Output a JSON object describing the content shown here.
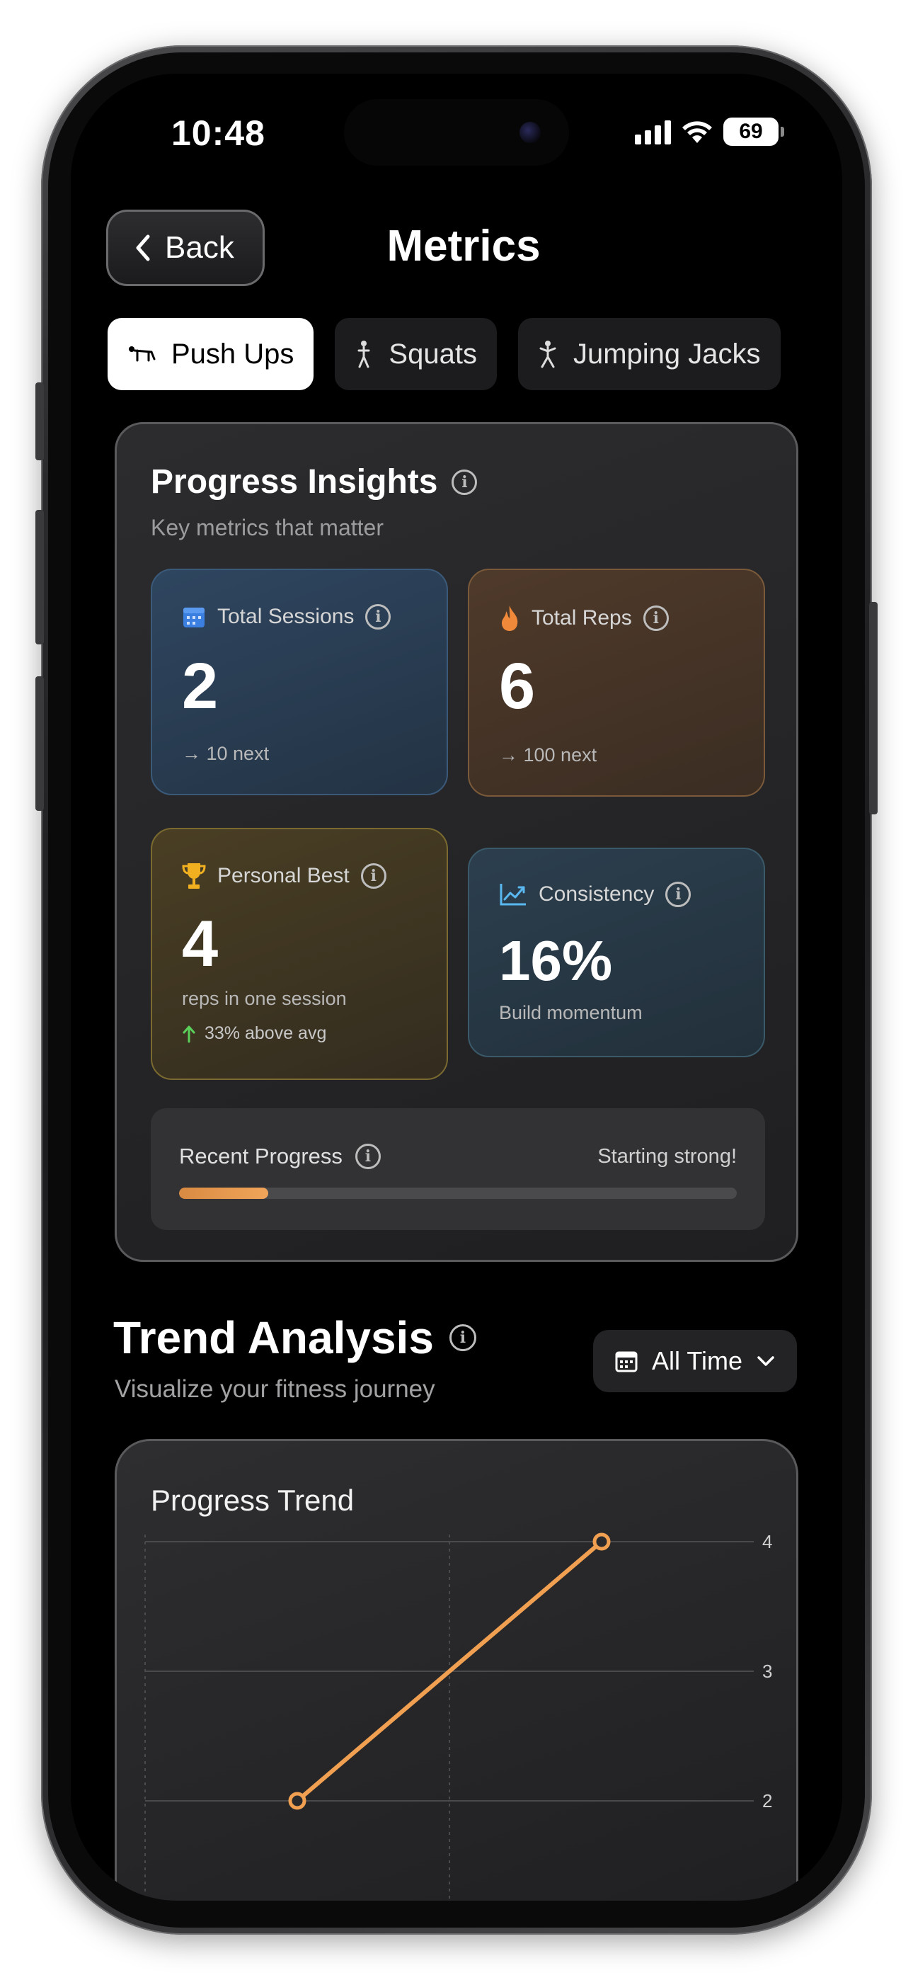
{
  "status": {
    "time": "10:48",
    "battery": "69"
  },
  "header": {
    "back_label": "Back",
    "title": "Metrics"
  },
  "tabs": [
    {
      "label": "Push Ups",
      "icon": "push-up-figure",
      "active": true
    },
    {
      "label": "Squats",
      "icon": "standing-figure",
      "active": false
    },
    {
      "label": "Jumping Jacks",
      "icon": "jumping-figure",
      "active": false
    }
  ],
  "insights": {
    "title": "Progress Insights",
    "subtitle": "Key metrics that matter",
    "sessions": {
      "label": "Total Sessions",
      "value": "2",
      "note": "→ 10 next",
      "icon": "calendar-icon"
    },
    "reps": {
      "label": "Total Reps",
      "value": "6",
      "note": "→ 100 next",
      "icon": "flame-icon"
    },
    "best": {
      "label": "Personal Best",
      "value": "4",
      "note": "reps in one session",
      "delta": "33% above avg",
      "icon": "trophy-icon"
    },
    "consistency": {
      "label": "Consistency",
      "value": "16%",
      "note": "Build momentum",
      "icon": "trend-chart-icon"
    },
    "recent": {
      "label": "Recent Progress",
      "status": "Starting strong!",
      "progress": 0.16
    }
  },
  "trend": {
    "title": "Trend Analysis",
    "subtitle": "Visualize your fitness journey",
    "range_label": "All Time"
  },
  "colors": {
    "accent_orange": "#f0a050",
    "background": "#000000"
  },
  "chart_data": {
    "type": "line",
    "title": "Progress Trend",
    "x": [
      1,
      2
    ],
    "values": [
      2,
      4
    ],
    "y_ticks": [
      "4",
      "3",
      "2"
    ],
    "ylim": [
      2,
      4
    ],
    "grid": true,
    "color": "#f0a050"
  }
}
